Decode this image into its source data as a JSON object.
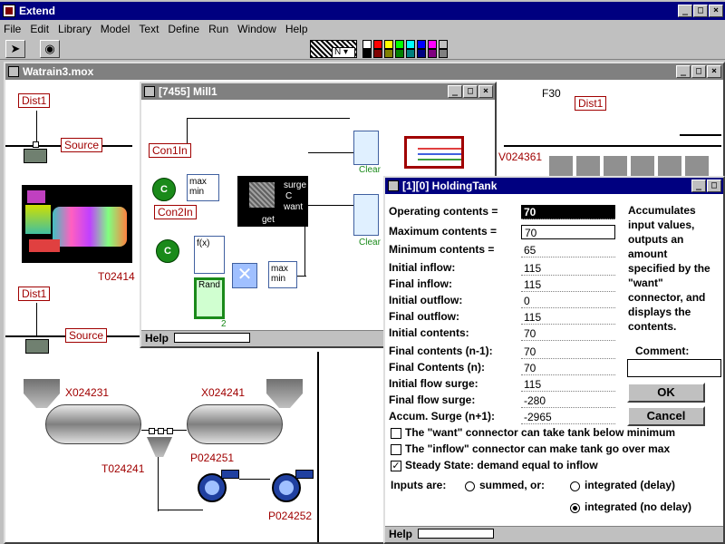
{
  "app": {
    "title": "Extend"
  },
  "menu": [
    "File",
    "Edit",
    "Library",
    "Model",
    "Text",
    "Define",
    "Run",
    "Window",
    "Help"
  ],
  "toolbar": {
    "style_value": "N"
  },
  "model_window": {
    "title": "Watrain3.mox"
  },
  "model_labels": {
    "dist1_a": "Dist1",
    "dist1_b": "Dist1",
    "dist1_c": "Dist1",
    "source_a": "Source",
    "source_b": "Source",
    "f30": "F30",
    "v024361": "V024361",
    "t02414": "T02414",
    "x024231": "X024231",
    "x024241": "X024241",
    "p024251": "P024251",
    "t024241": "T024241",
    "p024252": "P024252"
  },
  "mill_window": {
    "title": "[7455]   Mill1",
    "help": "Help",
    "con1in": "Con1In",
    "con2in": "Con2In",
    "c_a": "C",
    "c_b": "C",
    "maxmin_a": "max\nmin",
    "maxmin_b": "max\nmin",
    "fx": "f(x)",
    "rand": "Rand",
    "ports": {
      "surge": "surge",
      "c": "C",
      "want": "want",
      "get": "get"
    },
    "clear_a": "Clear",
    "clear_b": "Clear",
    "two": "2"
  },
  "dialog": {
    "title": "[1][0]   HoldingTank",
    "fields": [
      {
        "label": "Operating contents =",
        "value": "70"
      },
      {
        "label": "Maximum contents =",
        "value": "70"
      },
      {
        "label": "Minimum contents =",
        "value": "65"
      },
      {
        "label": "Initial inflow:",
        "value": "115"
      },
      {
        "label": "Final inflow:",
        "value": "115"
      },
      {
        "label": "Initial outflow:",
        "value": "0"
      },
      {
        "label": "Final outflow:",
        "value": "115"
      },
      {
        "label": "Initial contents:",
        "value": "70"
      },
      {
        "label": "Final contents (n-1):",
        "value": "70"
      },
      {
        "label": "Final Contents (n):",
        "value": "70"
      },
      {
        "label": "Initial flow surge:",
        "value": "115"
      },
      {
        "label": "Final flow surge:",
        "value": "-280"
      },
      {
        "label": "Accum. Surge (n+1):",
        "value": "-2965"
      }
    ],
    "description": "Accumulates input values, outputs an amount specified by the \"want\" connector, and displays the contents.",
    "comment_label": "Comment:",
    "ok": "OK",
    "cancel": "Cancel",
    "check1": "The \"want\" connector can take tank below minimum",
    "check2": "The \"inflow\" connector can make tank go over max",
    "check3": "Steady State: demand equal to inflow",
    "inputs_label": "Inputs are:",
    "radio1": "summed, or:",
    "radio2": "integrated (delay)",
    "radio3": "integrated (no delay)",
    "help": "Help"
  },
  "colors": {
    "titlebar_active": "#000080",
    "titlebar_inactive": "#808080",
    "label_red": "#a00000",
    "block_green": "#1a8a1a"
  }
}
